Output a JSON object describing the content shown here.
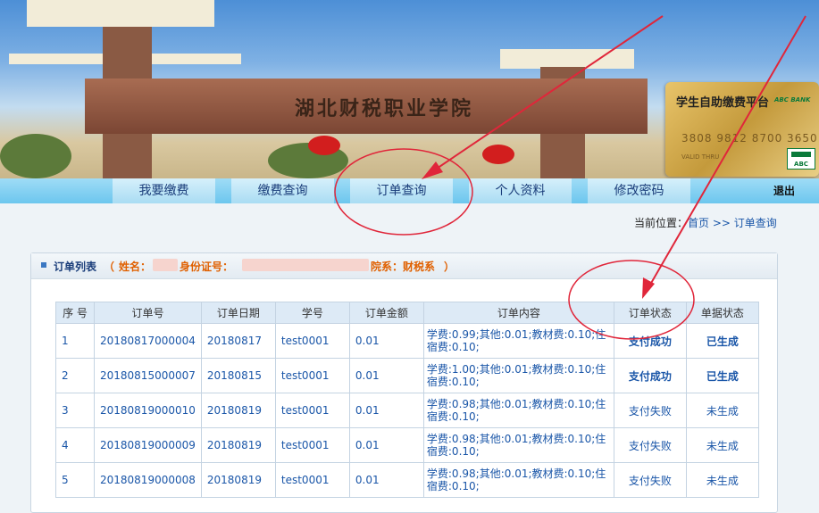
{
  "banner": {
    "school_name": "湖北财税职业学院",
    "card": {
      "title": "学生自助缴费平台",
      "bank": "ABC BANK",
      "number": "3808 9812 8700 3650",
      "sub": "VALID THRU",
      "logo_text": "ABC"
    }
  },
  "nav": {
    "items": [
      {
        "label": "我要缴费"
      },
      {
        "label": "缴费查询"
      },
      {
        "label": "订单查询"
      },
      {
        "label": "个人资料"
      },
      {
        "label": "修改密码"
      }
    ],
    "logout": "退出"
  },
  "breadcrumb": {
    "prefix": "当前位置：",
    "home": "首页",
    "sep": ">>",
    "current": "订单查询"
  },
  "panel": {
    "title": "订单列表",
    "open": "（",
    "name_label": "姓名：",
    "id_label": "身份证号：",
    "dept": "院系：财税系",
    "close": "）"
  },
  "table": {
    "headers": [
      "序 号",
      "订单号",
      "订单日期",
      "学号",
      "订单金额",
      "订单内容",
      "订单状态",
      "单据状态"
    ],
    "rows": [
      {
        "no": "1",
        "order": "20180817000004",
        "date": "20180817",
        "sid": "test0001",
        "amount": "0.01",
        "content": "学费:0.99;其他:0.01;教材费:0.10;住宿费:0.10;",
        "status": "支付成功",
        "doc": "已生成",
        "ok": true
      },
      {
        "no": "2",
        "order": "20180815000007",
        "date": "20180815",
        "sid": "test0001",
        "amount": "0.01",
        "content": "学费:1.00;其他:0.01;教材费:0.10;住宿费:0.10;",
        "status": "支付成功",
        "doc": "已生成",
        "ok": true
      },
      {
        "no": "3",
        "order": "20180819000010",
        "date": "20180819",
        "sid": "test0001",
        "amount": "0.01",
        "content": "学费:0.98;其他:0.01;教材费:0.10;住宿费:0.10;",
        "status": "支付失败",
        "doc": "未生成",
        "ok": false
      },
      {
        "no": "4",
        "order": "20180819000009",
        "date": "20180819",
        "sid": "test0001",
        "amount": "0.01",
        "content": "学费:0.98;其他:0.01;教材费:0.10;住宿费:0.10;",
        "status": "支付失败",
        "doc": "未生成",
        "ok": false
      },
      {
        "no": "5",
        "order": "20180819000008",
        "date": "20180819",
        "sid": "test0001",
        "amount": "0.01",
        "content": "学费:0.98;其他:0.01;教材费:0.10;住宿费:0.10;",
        "status": "支付失败",
        "doc": "未生成",
        "ok": false
      }
    ]
  },
  "colors": {
    "accent": "#1a56a8",
    "success": "#d00000",
    "title": "#e06000",
    "annotation": "#e0263a"
  }
}
